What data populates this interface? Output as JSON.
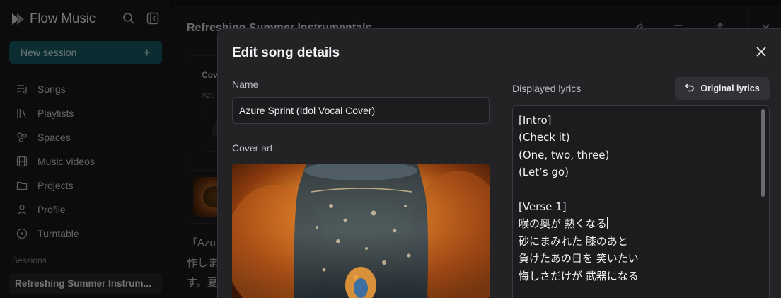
{
  "app": {
    "name": "Flow Music"
  },
  "sidebar": {
    "new_session_label": "New session",
    "items": [
      {
        "label": "Songs",
        "icon": "songs-icon"
      },
      {
        "label": "Playlists",
        "icon": "playlists-icon"
      },
      {
        "label": "Spaces",
        "icon": "spaces-icon"
      },
      {
        "label": "Music videos",
        "icon": "music-videos-icon"
      },
      {
        "label": "Projects",
        "icon": "folder-icon"
      },
      {
        "label": "Profile",
        "icon": "profile-icon"
      },
      {
        "label": "Turntable",
        "icon": "turntable-icon"
      }
    ],
    "sessions_label": "Sessions",
    "current_session": "Refreshing Summer Instrum..."
  },
  "main": {
    "title": "Refreshing Summer Instrumentals",
    "card_title": "Cov",
    "card_subtitle": "Azu",
    "description_lines": [
      "「Azu",
      "作しま",
      "す。夏"
    ]
  },
  "modal": {
    "title": "Edit song details",
    "name_label": "Name",
    "name_value": "Azure Sprint (Idol Vocal Cover)",
    "cover_label": "Cover art",
    "lyrics_label": "Displayed lyrics",
    "original_lyrics_button": "Original lyrics",
    "lyrics_before_caret": "[Intro]\n(Check it)\n(One, two, three)\n(Let’s go)\n\n[Verse 1]\n喉の奥が 熱くなる",
    "lyrics_after_caret": "\n砂にまみれた 膝のあと\n負けたあの日を 笑いたい\n悔しさだけが 武器になる"
  },
  "colors": {
    "accent": "#165a63",
    "modal_bg": "#232326",
    "sidebar_bg": "#18181b"
  }
}
